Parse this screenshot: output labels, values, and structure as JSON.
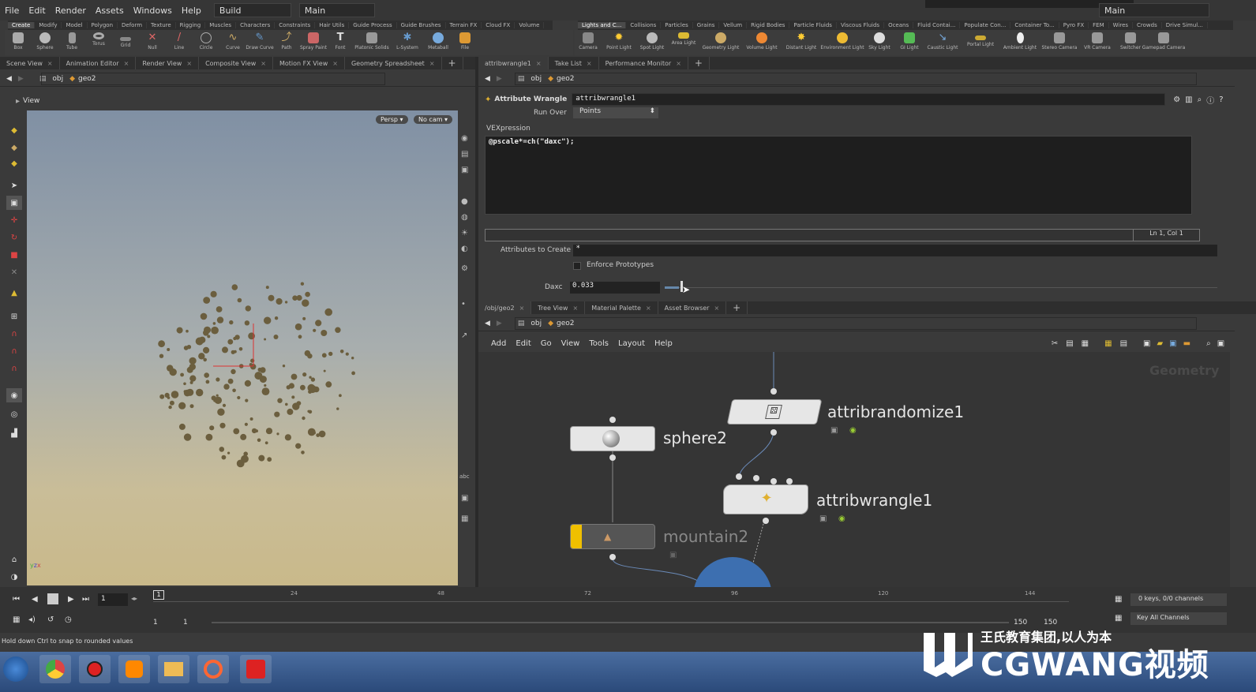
{
  "menubar": {
    "items": [
      "File",
      "Edit",
      "Render",
      "Assets",
      "Windows",
      "Help"
    ],
    "desktop": "Build",
    "workspace": "Main",
    "right_workspace": "Main"
  },
  "shelf_left": {
    "tabs": [
      "Create",
      "Modify",
      "Model",
      "Polygon",
      "Deform",
      "Texture",
      "Rigging",
      "Muscles",
      "Characters",
      "Constraints",
      "Hair Utils",
      "Guide Process",
      "Guide Brushes",
      "Terrain FX",
      "Cloud FX",
      "Volume"
    ],
    "tools": [
      "Box",
      "Sphere",
      "Tube",
      "Torus",
      "Grid",
      "Null",
      "Line",
      "Circle",
      "Curve",
      "Draw Curve",
      "Path",
      "Spray Paint",
      "Font",
      "Platonic Solids",
      "L-System",
      "Metaball",
      "File"
    ]
  },
  "shelf_right": {
    "tabs": [
      "Lights and C...",
      "Collisions",
      "Particles",
      "Grains",
      "Vellum",
      "Rigid Bodies",
      "Particle Fluids",
      "Viscous Fluids",
      "Oceans",
      "Fluid Contai...",
      "Populate Con...",
      "Container To...",
      "Pyro FX",
      "FEM",
      "Wires",
      "Crowds",
      "Drive Simul..."
    ],
    "tools": [
      "Camera",
      "Point Light",
      "Spot Light",
      "Area Light",
      "Geometry Light",
      "Volume Light",
      "Distant Light",
      "Environment Light",
      "Sky Light",
      "GI Light",
      "Caustic Light",
      "Portal Light",
      "Ambient Light",
      "Stereo Camera",
      "VR Camera",
      "Switcher",
      "Gamepad Camera"
    ]
  },
  "left_pane": {
    "tabs": [
      "Scene View",
      "Animation Editor",
      "Render View",
      "Composite View",
      "Motion FX View",
      "Geometry Spreadsheet"
    ],
    "path": [
      "obj",
      "geo2"
    ],
    "view_label": "View",
    "persp": "Persp ▾",
    "cam": "No cam ▾"
  },
  "param_pane": {
    "tabs": [
      "attribwrangle1",
      "Take List",
      "Performance Monitor"
    ],
    "path": [
      "obj",
      "geo2"
    ],
    "node_type": "Attribute Wrangle",
    "node_name": "attribwrangle1",
    "run_over_label": "Run Over",
    "run_over_value": "Points",
    "vex_label": "VEXpression",
    "vex_code": "@pscale*=ch(\"daxc\");",
    "cursor_pos": "Ln 1, Col 1",
    "attr_create_label": "Attributes to Create",
    "attr_create_value": "*",
    "enforce_label": "Enforce Prototypes",
    "daxc_label": "Daxc",
    "daxc_value": "0.033"
  },
  "network_pane": {
    "tabs": [
      "/obj/geo2",
      "Tree View",
      "Material Palette",
      "Asset Browser"
    ],
    "path": [
      "obj",
      "geo2"
    ],
    "menu": [
      "Add",
      "Edit",
      "Go",
      "View",
      "Tools",
      "Layout",
      "Help"
    ],
    "context_label": "Geometry",
    "nodes": [
      "sphere2",
      "attribrandomize1",
      "attribwrangle1",
      "mountain2"
    ]
  },
  "timeline": {
    "frame": "1",
    "ticks": [
      "24",
      "48",
      "72",
      "96",
      "120",
      "144"
    ],
    "current_marker": "1",
    "start": "1",
    "start2": "1",
    "end": "150",
    "end2": "150",
    "keys_label": "0 keys, 0/0 channels",
    "key_all": "Key All Channels"
  },
  "status": {
    "text": "Hold down Ctrl to snap to rounded values"
  },
  "watermark": {
    "line1": "王氏教育集团,以人为本",
    "line2": "CGWANG视频"
  },
  "colors": {
    "accent": "#f0c000",
    "node_bg": "#e6e6e6",
    "viewport_top": "#8090a4",
    "viewport_bottom": "#c9b98a"
  }
}
